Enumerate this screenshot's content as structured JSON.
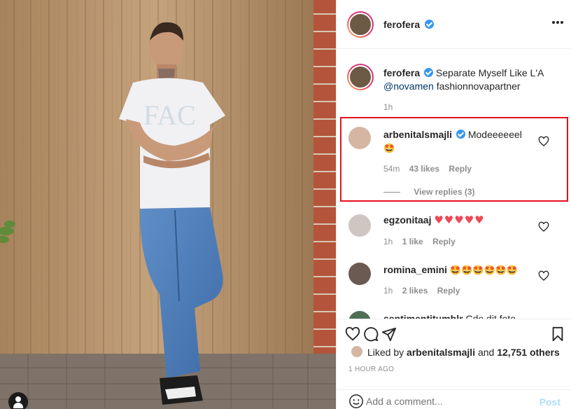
{
  "post": {
    "username": "ferofera",
    "more_label": "More options"
  },
  "caption": {
    "username": "ferofera",
    "text": "Separate Myself Like L'A",
    "mention": "@novamen",
    "tag_text": "fashionnovapartner",
    "time": "1h"
  },
  "comments": [
    {
      "username": "arbenitalsmajli",
      "verified": true,
      "text": "Modeeeeeel",
      "emoji": "🤩",
      "time": "54m",
      "likes": "43 likes",
      "reply": "Reply",
      "view_replies": "View replies (3)"
    },
    {
      "username": "egzonitaaj",
      "text": "",
      "emoji": "♥♥♥♥♥",
      "time": "1h",
      "likes": "1 like",
      "reply": "Reply"
    },
    {
      "username": "romina_emini",
      "text": "",
      "emoji": "🤩🤩🤩🤩🤩🤩",
      "time": "1h",
      "likes": "2 likes",
      "reply": "Reply"
    },
    {
      "username": "sentimentitumblr",
      "text": "Cdo dit foto"
    }
  ],
  "liked_by": {
    "prefix": "Liked by",
    "user": "arbenitalsmajli",
    "and": "and",
    "others": "12,751 others"
  },
  "timestamp": "1 HOUR AGO",
  "add_comment": {
    "placeholder": "Add a comment...",
    "post_label": "Post"
  },
  "colors": {
    "verified": "#3897f0",
    "highlight": "#e5101c",
    "heart_red": "#ed4956",
    "muted": "#8e8e8e"
  },
  "icons": {
    "like": "heart-icon",
    "comment": "comment-icon",
    "share": "share-icon",
    "save": "bookmark-icon",
    "emoji": "smiley-icon"
  }
}
